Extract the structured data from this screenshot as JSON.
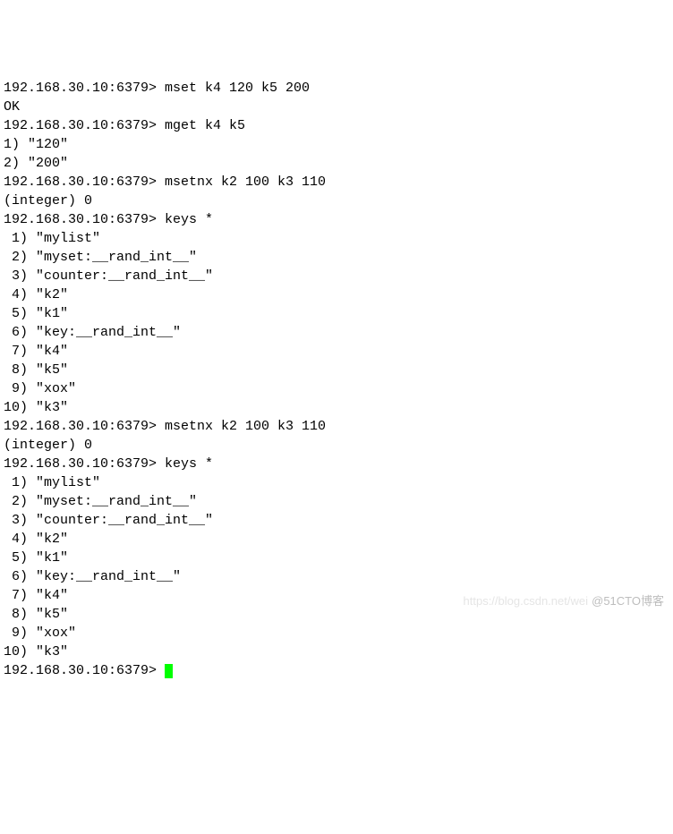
{
  "prompt": "192.168.30.10:6379>",
  "lines": [
    {
      "type": "cmd",
      "text": "192.168.30.10:6379> mset k4 120 k5 200"
    },
    {
      "type": "out",
      "text": "OK"
    },
    {
      "type": "cmd",
      "text": "192.168.30.10:6379> mget k4 k5"
    },
    {
      "type": "out",
      "text": "1) \"120\""
    },
    {
      "type": "out",
      "text": "2) \"200\""
    },
    {
      "type": "cmd",
      "text": "192.168.30.10:6379> msetnx k2 100 k3 110"
    },
    {
      "type": "out",
      "text": "(integer) 0"
    },
    {
      "type": "cmd",
      "text": "192.168.30.10:6379> keys *"
    },
    {
      "type": "out",
      "text": " 1) \"mylist\""
    },
    {
      "type": "out",
      "text": " 2) \"myset:__rand_int__\""
    },
    {
      "type": "out",
      "text": " 3) \"counter:__rand_int__\""
    },
    {
      "type": "out",
      "text": " 4) \"k2\""
    },
    {
      "type": "out",
      "text": " 5) \"k1\""
    },
    {
      "type": "out",
      "text": " 6) \"key:__rand_int__\""
    },
    {
      "type": "out",
      "text": " 7) \"k4\""
    },
    {
      "type": "out",
      "text": " 8) \"k5\""
    },
    {
      "type": "out",
      "text": " 9) \"xox\""
    },
    {
      "type": "out",
      "text": "10) \"k3\""
    },
    {
      "type": "cmd",
      "text": "192.168.30.10:6379> msetnx k2 100 k3 110"
    },
    {
      "type": "out",
      "text": "(integer) 0"
    },
    {
      "type": "cmd",
      "text": "192.168.30.10:6379> keys *"
    },
    {
      "type": "out",
      "text": " 1) \"mylist\""
    },
    {
      "type": "out",
      "text": " 2) \"myset:__rand_int__\""
    },
    {
      "type": "out",
      "text": " 3) \"counter:__rand_int__\""
    },
    {
      "type": "out",
      "text": " 4) \"k2\""
    },
    {
      "type": "out",
      "text": " 5) \"k1\""
    },
    {
      "type": "out",
      "text": " 6) \"key:__rand_int__\""
    },
    {
      "type": "out",
      "text": " 7) \"k4\""
    },
    {
      "type": "out",
      "text": " 8) \"k5\""
    },
    {
      "type": "out",
      "text": " 9) \"xox\""
    },
    {
      "type": "out",
      "text": "10) \"k3\""
    }
  ],
  "watermark_left": "https://blog.csdn.net/wei",
  "watermark_right": "@51CTO博客"
}
